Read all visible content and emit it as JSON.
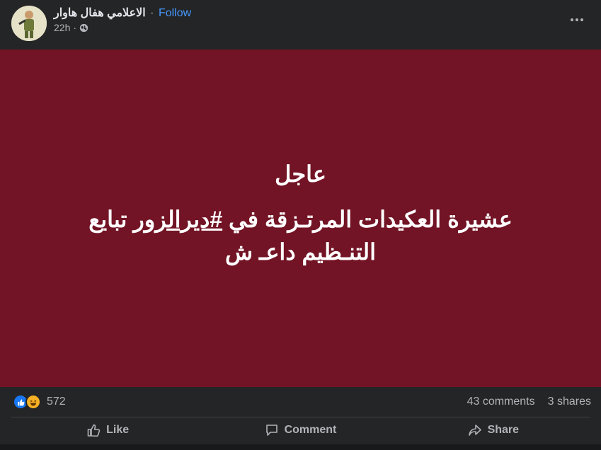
{
  "post": {
    "author": "الاعلامي هفال هاوار",
    "separator": "·",
    "follow_label": "Follow",
    "time": "22h",
    "privacy_icon": "globe-icon",
    "more_icon": "more-horizontal-icon"
  },
  "image": {
    "background": "#721425",
    "headline": "عاجل",
    "body_before": "عشيرة العكيدات المرتـزقة في ",
    "hashtag": "#ديرالزور",
    "body_after": " تبايع التنـظيم داعـ ش"
  },
  "stats": {
    "reaction_icons": [
      "like-icon",
      "haha-icon"
    ],
    "reaction_count": "572",
    "comments": "43 comments",
    "shares": "3 shares"
  },
  "actions": {
    "like": "Like",
    "comment": "Comment",
    "share": "Share"
  },
  "colors": {
    "background": "#242526",
    "text": "#e4e6eb",
    "secondary": "#b0b3b8",
    "follow": "#4599ff",
    "like_blue": "#1877f2"
  }
}
